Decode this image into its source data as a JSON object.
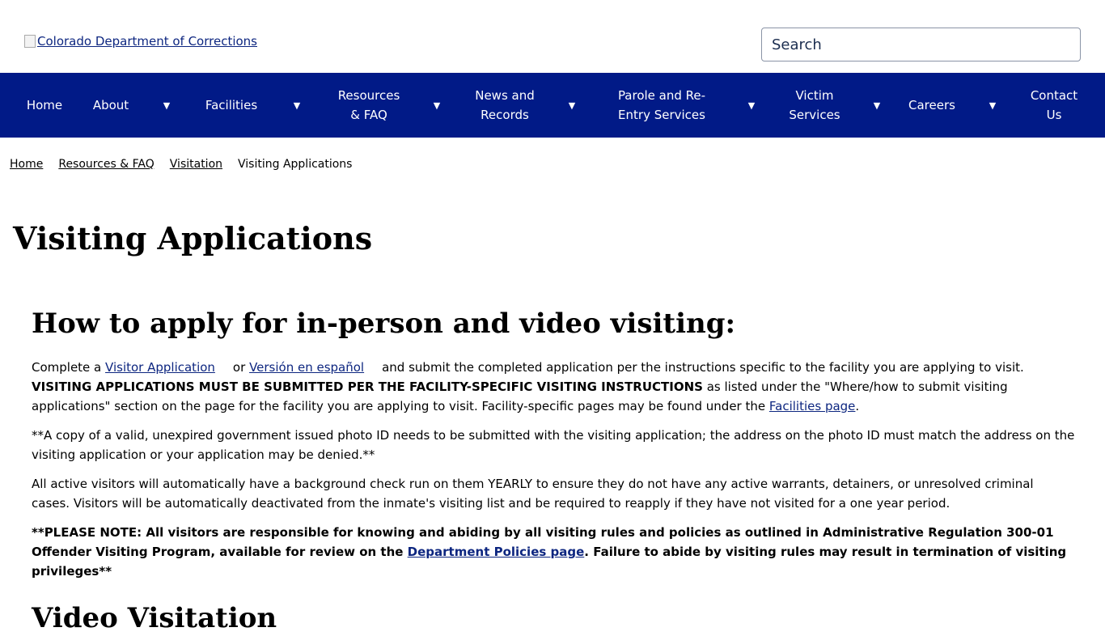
{
  "header": {
    "logo_alt": "Colorado Department of Corrections",
    "search_placeholder": "Search"
  },
  "nav": {
    "items": [
      {
        "label": "Home"
      },
      {
        "label": "About"
      },
      {
        "label": "Facilities"
      },
      {
        "label": "Resources & FAQ"
      },
      {
        "label": "News and Records"
      },
      {
        "label": "Parole and Re-Entry Services"
      },
      {
        "label": "Victim Services"
      },
      {
        "label": "Careers"
      },
      {
        "label": "Contact Us"
      }
    ],
    "caret_glyph": "▼"
  },
  "breadcrumb": {
    "items": [
      "Home",
      "Resources & FAQ",
      "Visitation"
    ],
    "current": "Visiting Applications"
  },
  "page": {
    "title": "Visiting Applications",
    "section1_title": "How to apply for in-person and video visiting:",
    "p1": {
      "a": "Complete a ",
      "link1": "Visitor Application",
      "b": "or",
      "link2": "Versión en español",
      "c": "and submit the completed application per the instructions specific to the facility you are applying to visit.",
      "bold": "VISITING APPLICATIONS MUST BE SUBMITTED PER THE FACILITY-SPECIFIC VISITING INSTRUCTIONS",
      "d": " as listed under the \"Where/how to submit visiting applications\" section on the page for the facility you are applying to visit. Facility-specific pages may be found under the ",
      "link3": "Facilities page",
      "e": "."
    },
    "p2": "**A copy of a valid, unexpired government issued photo ID needs to be submitted with the visiting application; the address on the photo ID must match the address on the visiting application or your application may be denied.**",
    "p3": "All active visitors will automatically have a background check run on them YEARLY to ensure they do not have any active warrants, detainers, or unresolved criminal cases.  Visitors will be automatically deactivated from the inmate's visiting list and be required to reapply if they have not visited for a one year period.",
    "p4": {
      "a": "**PLEASE NOTE: All visitors are responsible for knowing and abiding by all visiting rules and policies as outlined in Administrative Regulation 300-01 Offender Visiting Program, available for review on the ",
      "link": "Department Policies page",
      "b": ".  Failure to abide by visiting rules may result in termination of visiting privileges**"
    },
    "section2_title": "Video Visitation"
  }
}
